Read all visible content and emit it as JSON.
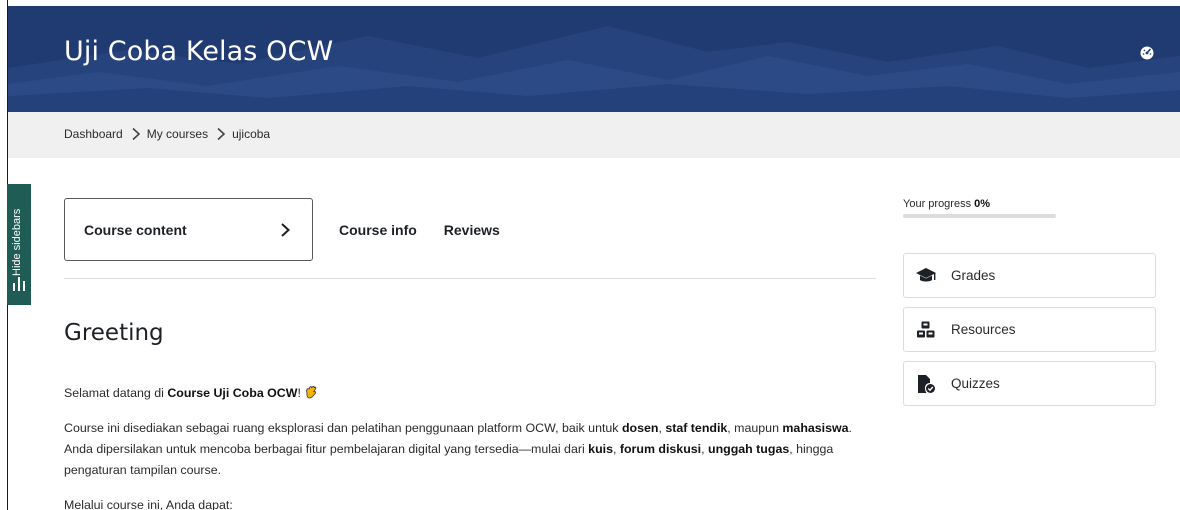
{
  "header": {
    "course_title": "Uji Coba Kelas OCW",
    "colors": {
      "bg": "#1f3b72",
      "accent": "#1f5c55"
    }
  },
  "breadcrumb": {
    "items": [
      "Dashboard",
      "My courses",
      "ujicoba"
    ]
  },
  "sidebar_toggle": {
    "label": "Hide sidebars"
  },
  "tabs": [
    {
      "label": "Course content",
      "active": true
    },
    {
      "label": "Course info",
      "active": false
    },
    {
      "label": "Reviews",
      "active": false
    }
  ],
  "section": {
    "title": "Greeting",
    "p1": {
      "before": "Selamat datang di ",
      "bold": "Course Uji Coba OCW",
      "after": "!"
    },
    "p2": {
      "t1": "Course ini disediakan sebagai ruang eksplorasi dan pelatihan penggunaan platform OCW, baik untuk ",
      "b1": "dosen",
      "t2": ", ",
      "b2": "staf tendik",
      "t3": ", maupun ",
      "b3": "mahasiswa",
      "t4": ". Anda dipersilakan untuk mencoba berbagai fitur pembelajaran digital yang tersedia—mulai dari ",
      "b4": "kuis",
      "t5": ", ",
      "b5": "forum diskusi",
      "t6": ", ",
      "b6": "unggah tugas",
      "t7": ", hingga pengaturan tampilan course."
    },
    "p3": "Melalui course ini, Anda dapat:"
  },
  "progress": {
    "label": "Your progress ",
    "value_text": "0%",
    "value": 0
  },
  "side_links": [
    {
      "label": "Grades",
      "icon": "graduation-cap-icon"
    },
    {
      "label": "Resources",
      "icon": "cubes-icon"
    },
    {
      "label": "Quizzes",
      "icon": "file-check-icon"
    }
  ]
}
